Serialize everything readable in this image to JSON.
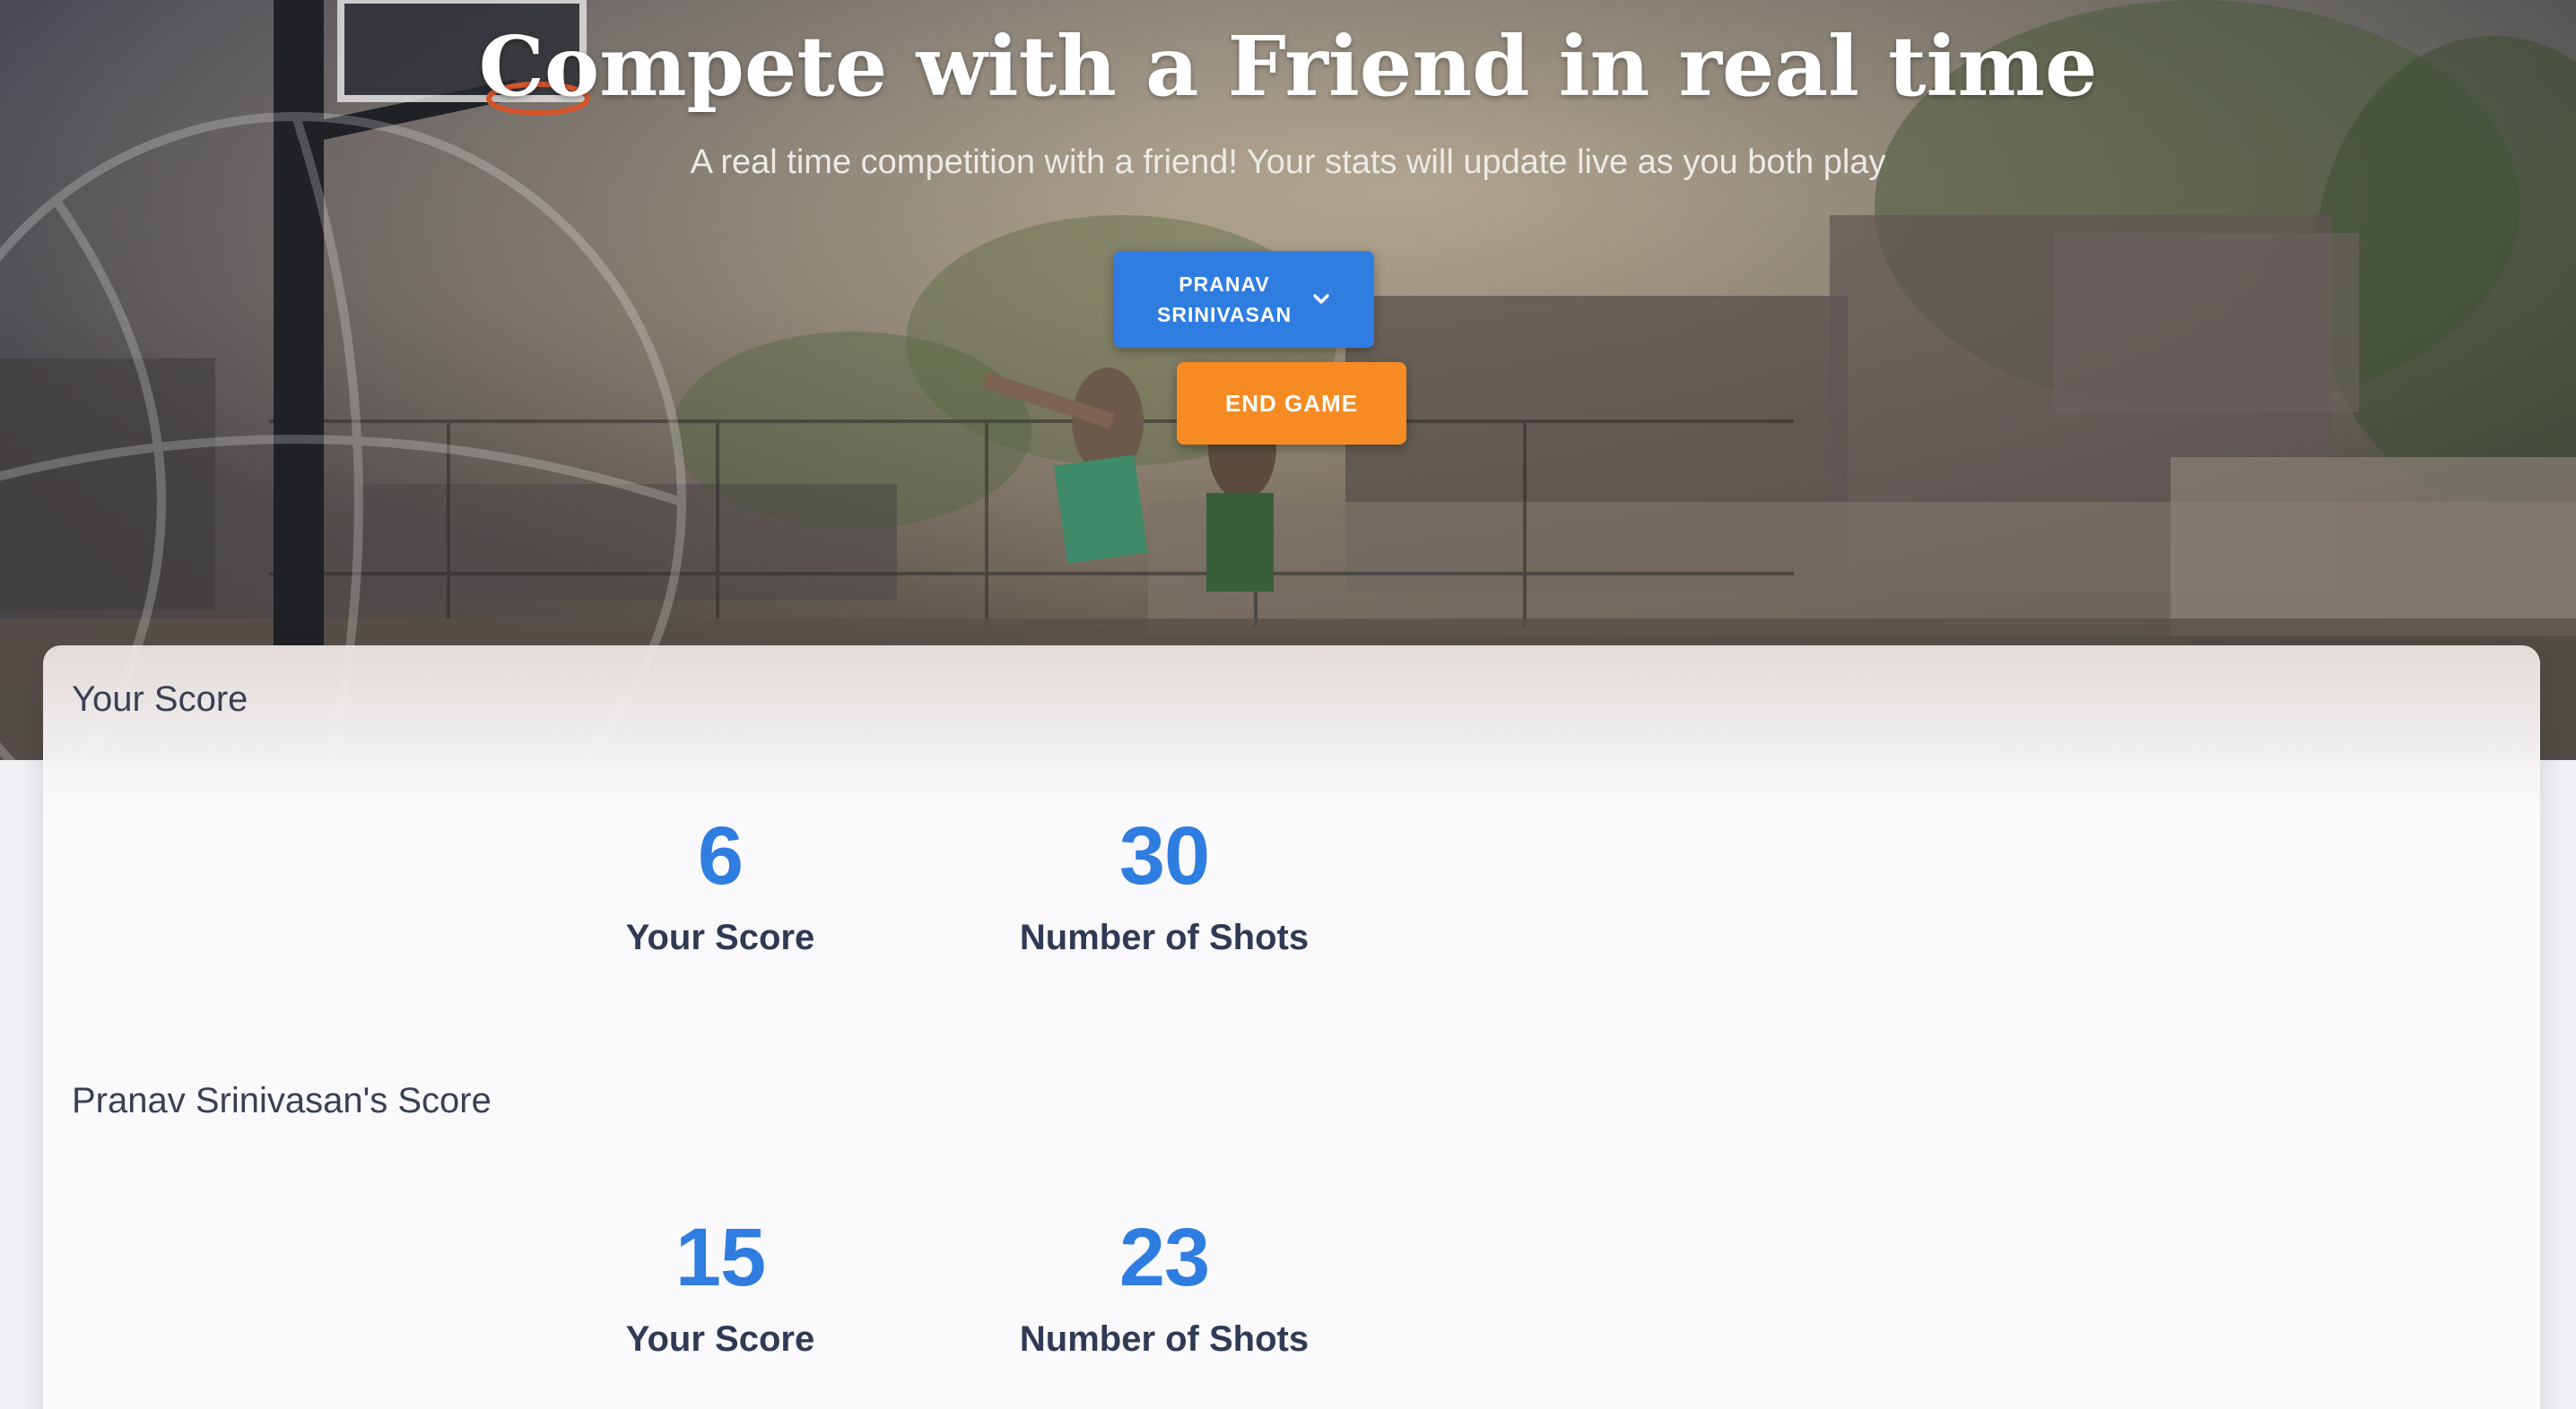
{
  "hero": {
    "title": "Compete with a Friend in real time",
    "subtitle": "A real time competition with a friend! Your stats will update live as you both play",
    "friend_select": {
      "label": "PRANAV SRINIVASAN",
      "icon": "chevron-down-icon"
    },
    "end_game_label": "END GAME",
    "background_icon": "basketball-icon"
  },
  "your_section": {
    "heading": "Your Score",
    "stats": [
      {
        "value": "6",
        "caption": "Your Score"
      },
      {
        "value": "30",
        "caption": "Number of Shots"
      }
    ]
  },
  "friend_section": {
    "heading": "Pranav Srinivasan's Score",
    "stats": [
      {
        "value": "15",
        "caption": "Your Score"
      },
      {
        "value": "23",
        "caption": "Number of Shots"
      }
    ]
  },
  "colors": {
    "primary": "#2f7de1",
    "accent": "#f68b23",
    "text_dark": "#2f3a55"
  }
}
